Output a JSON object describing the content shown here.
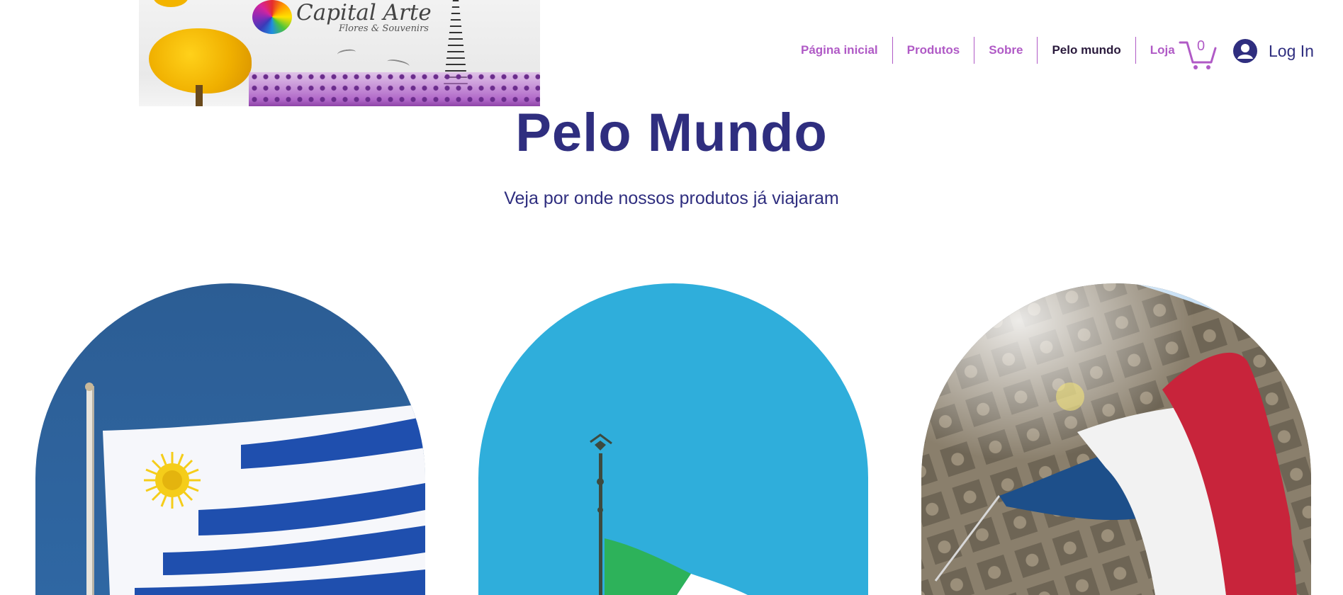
{
  "logo": {
    "brand": "Capital Arte",
    "tagline": "Flores & Souvenirs"
  },
  "nav": {
    "items": [
      {
        "label": "Página inicial",
        "active": false
      },
      {
        "label": "Produtos",
        "active": false
      },
      {
        "label": "Sobre",
        "active": false
      },
      {
        "label": "Pelo mundo",
        "active": true
      },
      {
        "label": "Loja",
        "active": false
      }
    ]
  },
  "cart": {
    "count": "0",
    "icon": "cart-icon"
  },
  "login": {
    "label": "Log In",
    "icon": "user-avatar-icon"
  },
  "hero": {
    "title": "Pelo Mundo",
    "subtitle": "Veja por onde nossos produtos já viajaram"
  },
  "cards": [
    {
      "image": "uruguay-flag-image"
    },
    {
      "image": "italy-flag-image"
    },
    {
      "image": "france-flag-image"
    }
  ],
  "colors": {
    "accent": "#b05ac6",
    "heading": "#2f2e7f",
    "active_nav": "#2a1a3c"
  }
}
